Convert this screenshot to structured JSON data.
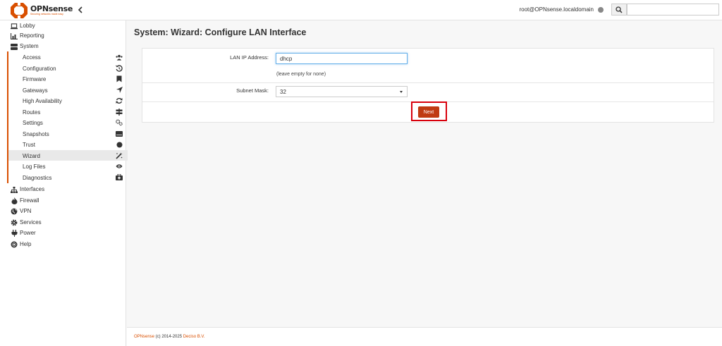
{
  "header": {
    "logo_name": "OPNsense",
    "logo_tagline": "Securing networks made easy",
    "user": "root@OPNsense.localdomain",
    "search_placeholder": ""
  },
  "sidebar": {
    "top_items": [
      {
        "label": "Lobby",
        "icon": "laptop-icon"
      },
      {
        "label": "Reporting",
        "icon": "chart-icon"
      },
      {
        "label": "System",
        "icon": "server-icon"
      }
    ],
    "system_items": [
      {
        "label": "Access",
        "icon": "users-icon"
      },
      {
        "label": "Configuration",
        "icon": "history-icon"
      },
      {
        "label": "Firmware",
        "icon": "bookmark-icon"
      },
      {
        "label": "Gateways",
        "icon": "location-arrow-icon"
      },
      {
        "label": "High Availability",
        "icon": "refresh-icon"
      },
      {
        "label": "Routes",
        "icon": "signpost-icon"
      },
      {
        "label": "Settings",
        "icon": "cogs-icon"
      },
      {
        "label": "Snapshots",
        "icon": "hdd-icon"
      },
      {
        "label": "Trust",
        "icon": "certificate-icon"
      },
      {
        "label": "Wizard",
        "icon": "magic-icon"
      },
      {
        "label": "Log Files",
        "icon": "eye-icon"
      },
      {
        "label": "Diagnostics",
        "icon": "medkit-icon"
      }
    ],
    "bottom_items": [
      {
        "label": "Interfaces",
        "icon": "sitemap-icon"
      },
      {
        "label": "Firewall",
        "icon": "fire-icon"
      },
      {
        "label": "VPN",
        "icon": "globe-icon"
      },
      {
        "label": "Services",
        "icon": "cog-icon"
      },
      {
        "label": "Power",
        "icon": "plug-icon"
      },
      {
        "label": "Help",
        "icon": "life-ring-icon"
      }
    ]
  },
  "page": {
    "title": "System: Wizard: Configure LAN Interface"
  },
  "form": {
    "lan_label": "LAN IP Address:",
    "lan_value": "dhcp",
    "lan_hint": "(leave empty for none)",
    "subnet_label": "Subnet Mask:",
    "subnet_value": "32",
    "next_label": "Next"
  },
  "footer": {
    "product": "OPNsense",
    "copyright": " (c) 2014-2025 ",
    "vendor": "Deciso B.V."
  },
  "colors": {
    "accent": "#d94f00",
    "button": "#c03a12",
    "highlight_box": "#d8000c"
  }
}
